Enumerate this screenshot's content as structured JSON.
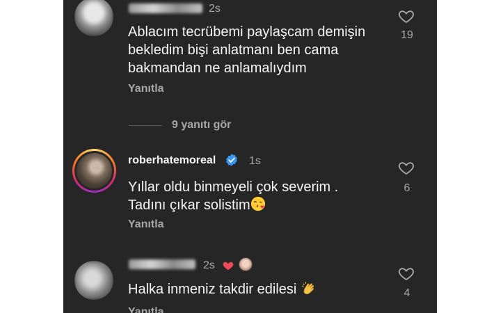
{
  "comments": [
    {
      "time": "2s",
      "lines": [
        "Ablacım tecrübemi paylaşcam demişin",
        "bekledim bişi anlatmanı ben cama",
        "bakmandan ne anlamalıydım"
      ],
      "reply_label": "Yanıtla",
      "likes": "19",
      "icon": "heart-outline-icon"
    },
    {
      "username": "roberhatemoreal",
      "verified": true,
      "time": "1s",
      "lines": [
        "Yıllar oldu binmeyeli çok severim .",
        "Tadını çıkar solistim"
      ],
      "reply_label": "Yanıtla",
      "likes": "6",
      "icon": "heart-outline-icon",
      "emoji": "kissing-face-emoji"
    },
    {
      "time": "2s",
      "lines": [
        "Halka inmeniz takdir edilesi"
      ],
      "reply_label": "Yanıtla",
      "likes": "4",
      "icon": "heart-outline-icon",
      "emoji": "clapping-hands-emoji"
    }
  ],
  "view_replies": "9 yanıtı gör",
  "colors": {
    "background": "#262626",
    "text": "#f5f5f5",
    "secondary": "#a8a8a8",
    "verified": "#3897f0",
    "liked_heart": "#ed4956"
  }
}
